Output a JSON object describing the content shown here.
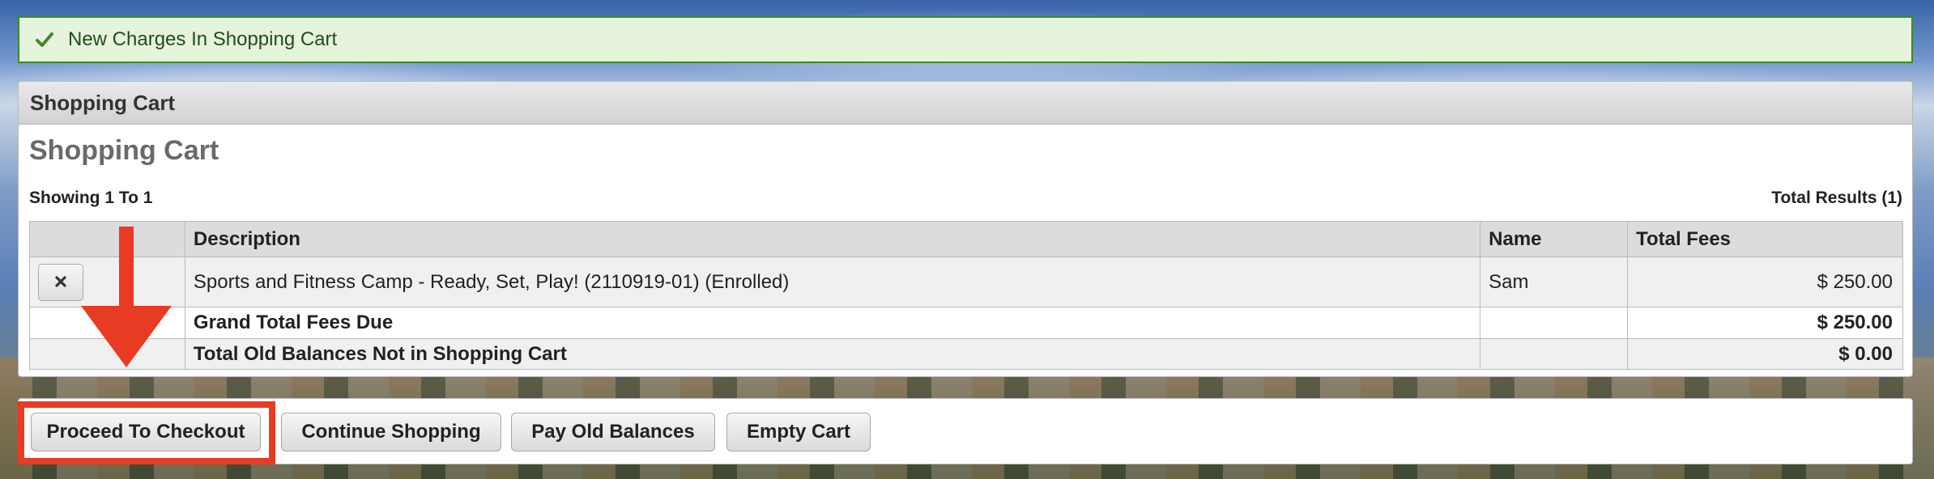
{
  "alert": {
    "message": "New Charges In Shopping Cart",
    "icon": "check-icon",
    "color": "#3f8a2a"
  },
  "panel": {
    "header": "Shopping Cart",
    "title": "Shopping Cart",
    "showing": "Showing 1 To 1",
    "total_results": "Total Results (1)"
  },
  "table": {
    "columns": [
      "",
      "Description",
      "Name",
      "Total Fees"
    ],
    "rows": [
      {
        "remove_icon": "close-icon",
        "description": "Sports and Fitness Camp - Ready, Set, Play! (2110919-01) (Enrolled)",
        "name": "Sam",
        "fees": "$ 250.00"
      }
    ],
    "grand_total_label": "Grand Total Fees Due",
    "grand_total_value": "$ 250.00",
    "old_balances_label": "Total Old Balances Not in Shopping Cart",
    "old_balances_value": "$ 0.00"
  },
  "buttons": {
    "checkout": "Proceed To Checkout",
    "continue": "Continue Shopping",
    "pay_old": "Pay Old Balances",
    "empty": "Empty Cart"
  },
  "annotation": {
    "highlight_color": "#e83b23",
    "arrow_icon": "arrow-down-icon"
  }
}
